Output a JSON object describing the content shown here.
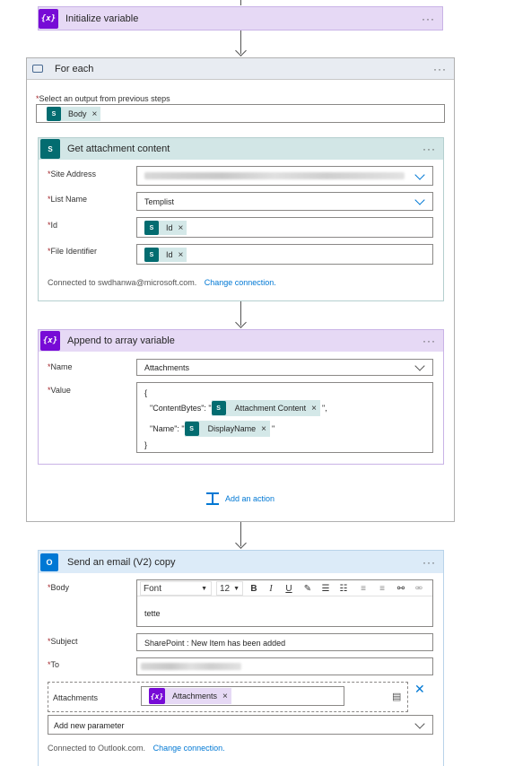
{
  "init_variable": {
    "title": "Initialize variable",
    "icon": "variable-icon",
    "more": "···"
  },
  "for_each": {
    "title": "For each",
    "more": "···",
    "output_label": "Select an output from previous steps",
    "output_token": "Body",
    "add_action": "Add an action"
  },
  "get_attachment": {
    "title": "Get attachment content",
    "more": "···",
    "site_address_label": "Site Address",
    "list_name_label": "List Name",
    "list_name_value": "Templist",
    "id_label": "Id",
    "id_token": "Id",
    "file_identifier_label": "File Identifier",
    "file_identifier_token": "Id",
    "connected_text": "Connected to swdhanwa@microsoft.com.",
    "change_connection": "Change connection."
  },
  "append_array": {
    "title": "Append to array variable",
    "more": "···",
    "name_label": "Name",
    "name_value": "Attachments",
    "value_label": "Value",
    "open_brace": "{",
    "content_bytes_key": "\"ContentBytes\": \"",
    "content_bytes_token": "Attachment Content",
    "content_bytes_suffix": "\",",
    "name_key": "\"Name\": \"",
    "name_token": "DisplayName",
    "name_suffix": "\"",
    "close_brace": "}"
  },
  "send_email": {
    "title": "Send an email (V2) copy",
    "more": "···",
    "body_label": "Body",
    "font_value": "Font",
    "font_size_value": "12",
    "body_text": "tette",
    "subject_label": "Subject",
    "subject_value": "SharePoint : New Item has been added",
    "to_label": "To",
    "attachments_label": "Attachments",
    "attachments_token": "Attachments",
    "add_param_placeholder": "Add new parameter",
    "connected_text": "Connected to Outlook.com.",
    "change_connection": "Change connection."
  },
  "common": {
    "required_mark": "*",
    "remove_mark": "×",
    "sp_badge": "S"
  },
  "colors": {
    "variable": "#770bd6",
    "sharepoint": "#036c70",
    "outlook": "#0078d4",
    "link": "#0078d4"
  }
}
